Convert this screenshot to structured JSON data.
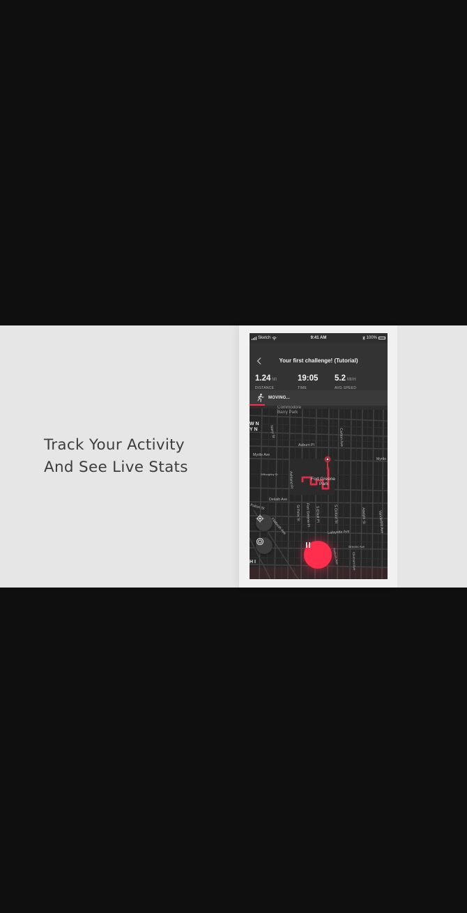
{
  "headline": {
    "line1": "Track Your Activity",
    "line2": "And See Live Stats"
  },
  "statusbar": {
    "carrier": "Sketch",
    "time": "9:41 AM",
    "battery": "100%"
  },
  "header": {
    "title": "Your first challenge! (Tutorial)",
    "back_icon": "chevron-left-icon"
  },
  "stats": [
    {
      "value": "1.24",
      "unit": "MI",
      "label": "DISTANCE"
    },
    {
      "value": "19:05",
      "unit": "",
      "label": "TIME"
    },
    {
      "value": "5.2",
      "unit": "MI/H",
      "label": "AVG SPEED"
    }
  ],
  "activity": {
    "status": "MOVING...",
    "icon": "runner-icon",
    "progress": 0.11
  },
  "map": {
    "labels": {
      "commodore": "Commodore",
      "barry_park": "Barry Park",
      "park_name_1": "Fort Greene",
      "park_name_2": "Park",
      "myrtle_ave": "Myrtle Ave",
      "myrtle_right": "Myrtle",
      "dekalb_ave": "Dekalb Ave",
      "lafayette_ave": "Lafayette Ave",
      "auburn_pl": "Auburn Pl",
      "willoughby": "Willoughby St",
      "ashland_pl": "Ashland Pl",
      "fulton_st": "Fulton St",
      "flatbush_ave": "Flatbush Ave",
      "greene_ave": "Greene Ave",
      "vanderbilt": "Vanderbilt Ave",
      "navy_st": "Navy St",
      "carlton_ave": "Carlton Ave",
      "adelphi_st": "Adelphi St",
      "s_oxford": "S Oxford St",
      "s_elliott": "S Elliott Pl",
      "ft_greene_pl": "Fort Greene Pl",
      "st_felix": "St Felix St",
      "hudson_ave": "Hudson Ave",
      "clermont": "Clermont Ave",
      "left_1": "W N",
      "left_2": "Y N",
      "left_3": "H I"
    }
  },
  "controls": {
    "locate_icon": "locate-icon",
    "target_icon": "target-icon",
    "pause_icon": "pause-icon"
  },
  "colors": {
    "accent": "#ff2e4d",
    "band": "#e6e6e6",
    "background": "#0f0f0f"
  }
}
